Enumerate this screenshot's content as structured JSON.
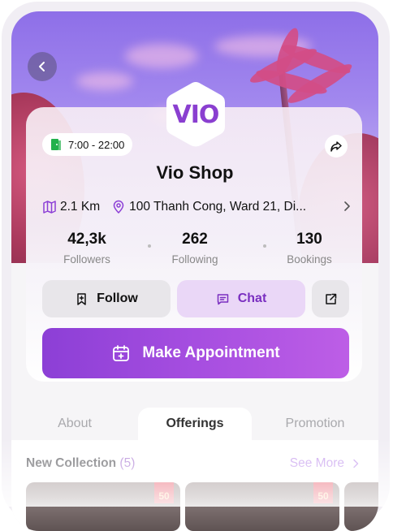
{
  "shop": {
    "logo_text": "VIO",
    "name": "Vio Shop",
    "hours": "7:00 - 22:00",
    "distance": "2.1 Km",
    "address": "100 Thanh Cong, Ward 21, Di..."
  },
  "stats": [
    {
      "value": "42,3k",
      "label": "Followers"
    },
    {
      "value": "262",
      "label": "Following"
    },
    {
      "value": "130",
      "label": "Bookings"
    }
  ],
  "actions": {
    "follow_label": "Follow",
    "chat_label": "Chat",
    "appointment_label": "Make Appointment"
  },
  "tabs": [
    {
      "label": "About",
      "active": false
    },
    {
      "label": "Offerings",
      "active": true
    },
    {
      "label": "Promotion",
      "active": false
    }
  ],
  "collection": {
    "title": "New Collection",
    "count": "(5)",
    "see_more_label": "See More",
    "badges": [
      "50",
      "50"
    ]
  },
  "colors": {
    "accent": "#8c3fd6",
    "chat_bg": "#ead7f7",
    "hours_icon": "#22b14c"
  },
  "icons": [
    "back-arrow-icon",
    "door-icon",
    "share-icon",
    "map-icon",
    "location-pin-icon",
    "chevron-right-icon",
    "bookmark-plus-icon",
    "chat-icon",
    "external-link-icon",
    "calendar-plus-icon"
  ]
}
